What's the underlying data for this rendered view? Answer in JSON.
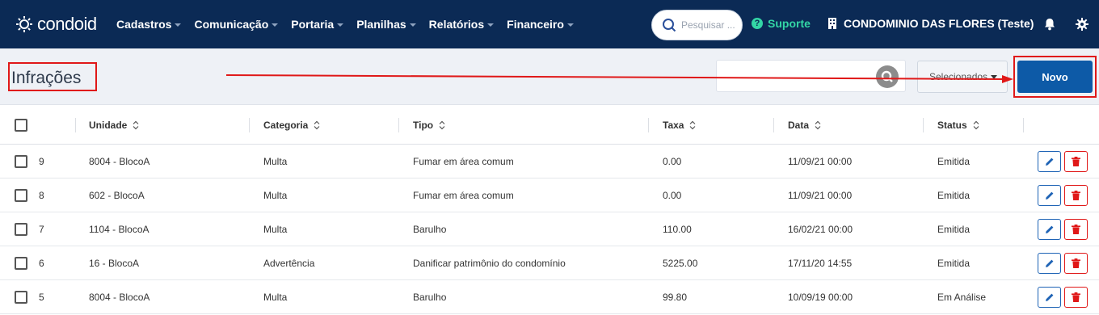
{
  "brand": {
    "name": "condoid"
  },
  "nav": {
    "items": [
      {
        "label": "Cadastros"
      },
      {
        "label": "Comunicação"
      },
      {
        "label": "Portaria"
      },
      {
        "label": "Planilhas"
      },
      {
        "label": "Relatórios"
      },
      {
        "label": "Financeiro"
      }
    ]
  },
  "header": {
    "search_placeholder": "Pesquisar ...",
    "support_label": "Suporte",
    "condo_name": "CONDOMINIO DAS FLORES (Teste)"
  },
  "page": {
    "title": "Infrações",
    "filter_value": "",
    "select_label": "Selecionados",
    "new_button": "Novo"
  },
  "table": {
    "columns": [
      "Unidade",
      "Categoria",
      "Tipo",
      "Taxa",
      "Data",
      "Status"
    ],
    "rows": [
      {
        "id": "9",
        "unidade": "8004 - BlocoA",
        "categoria": "Multa",
        "tipo": "Fumar em área comum",
        "taxa": "0.00",
        "data": "11/09/21 00:00",
        "status": "Emitida"
      },
      {
        "id": "8",
        "unidade": "602 - BlocoA",
        "categoria": "Multa",
        "tipo": "Fumar em área comum",
        "taxa": "0.00",
        "data": "11/09/21 00:00",
        "status": "Emitida"
      },
      {
        "id": "7",
        "unidade": "1104 - BlocoA",
        "categoria": "Multa",
        "tipo": "Barulho",
        "taxa": "110.00",
        "data": "16/02/21 00:00",
        "status": "Emitida"
      },
      {
        "id": "6",
        "unidade": "16 - BlocoA",
        "categoria": "Advertência",
        "tipo": "Danificar patrimônio do condomínio",
        "taxa": "5225.00",
        "data": "17/11/20 14:55",
        "status": "Emitida"
      },
      {
        "id": "5",
        "unidade": "8004 - BlocoA",
        "categoria": "Multa",
        "tipo": "Barulho",
        "taxa": "99.80",
        "data": "10/09/19 00:00",
        "status": "Em Análise"
      }
    ]
  },
  "colors": {
    "navbar": "#0b2a55",
    "accent": "#0d5aa7",
    "support": "#33d6a6",
    "annotation": "#e01818"
  },
  "icons": [
    "search-icon",
    "help-circle-icon",
    "building-icon",
    "bell-icon",
    "gear-icon",
    "sort-icon",
    "pencil-icon",
    "trash-icon"
  ]
}
